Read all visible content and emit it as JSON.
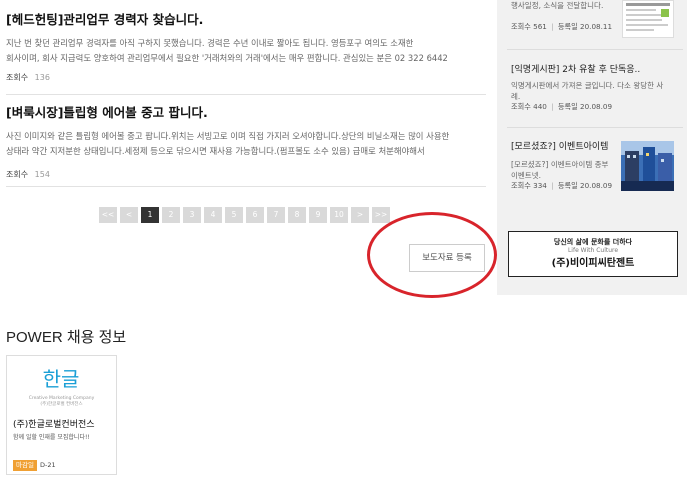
{
  "articles": [
    {
      "title": "[헤드헌팅]관리업무 경력자 찾습니다.",
      "body_lines": [
        "지난 번 찾던 관리업무 경력자를 아직 구하지 못했습니다. 경력은  수년 이내로 짧아도 됩니다.  영등포구 여의도 소재한",
        "회사이며, 회사 지급력도 양호하여 관리업무에서 필요한 '거래처와의 거래'에서는 매우 편합니다. 관심있는 분은 02  322 6442"
      ],
      "views_label": "조회수",
      "views": "136"
    },
    {
      "title": "[벼룩시장]틀립형 에어볼 중고 팝니다.",
      "body_lines": [
        "사진 이미지와 같은 틀립형 에어볼 중고 팝니다.위치는 서빙고로 이며 직접 가지러 오셔야합니다.상단의 비닐소재는 많이 사용한",
        "상태라 약간 지저분한 상태입니다.세정제 등으로 닦으시면 재사용 가능합니다.(펌프볼도 소수 있음) 급매로 처분해야해서"
      ],
      "views_label": "조회수",
      "views": "154"
    }
  ],
  "pagination": {
    "first": "<<",
    "prev": "<",
    "pages": [
      "1",
      "2",
      "3",
      "4",
      "5",
      "6",
      "7",
      "8",
      "9",
      "10"
    ],
    "current": "1",
    "next": ">",
    "last": ">>"
  },
  "register_button": "보도자료 등록",
  "sidebar": {
    "items": [
      {
        "title": "",
        "body": "행사일정, 소식을 전달합니다.",
        "views_label": "조회수",
        "views": "561",
        "date_label": "등록일",
        "date": "20.08.11"
      },
      {
        "title": "[익명게시판] 2차 유찰 후 단독응..",
        "body": "익명게시판에서 가져온 글입니다. 다소 왕당한 사례.",
        "views_label": "조회수",
        "views": "440",
        "date_label": "등록일",
        "date": "20.08.09"
      },
      {
        "title": "[모르셨죠?] 이벤트아이템",
        "body": "[모르셨죠?] 이벤트아이템 종부",
        "body2": "이벤트넷.",
        "views_label": "조회수",
        "views": "334",
        "date_label": "등록일",
        "date": "20.08.09"
      }
    ],
    "banner": {
      "line1": "당신의 삶에 문화를 더하다",
      "line2": "Life With Culture",
      "line3": "(주)비이피씨탄젠트"
    }
  },
  "power": {
    "title": "POWER 채용 정보",
    "card": {
      "logo_text": "한글",
      "company_en": "Creative Marketing Company",
      "company_small": "(주)한글로벌 컨버전스",
      "name": "(주)한글로벌컨버전스",
      "desc": "함께 일할 인재를 모집합니다!!",
      "tag": "마감일",
      "dday": "D-21"
    }
  },
  "colors": {
    "highlight_ellipse": "#d8242b",
    "pager_inactive": "#d9d9d9",
    "pager_active": "#333333",
    "sidebar_bg": "#f1f1f1",
    "logo_accent": "#1a9fd6",
    "tag": "#f0a033"
  }
}
